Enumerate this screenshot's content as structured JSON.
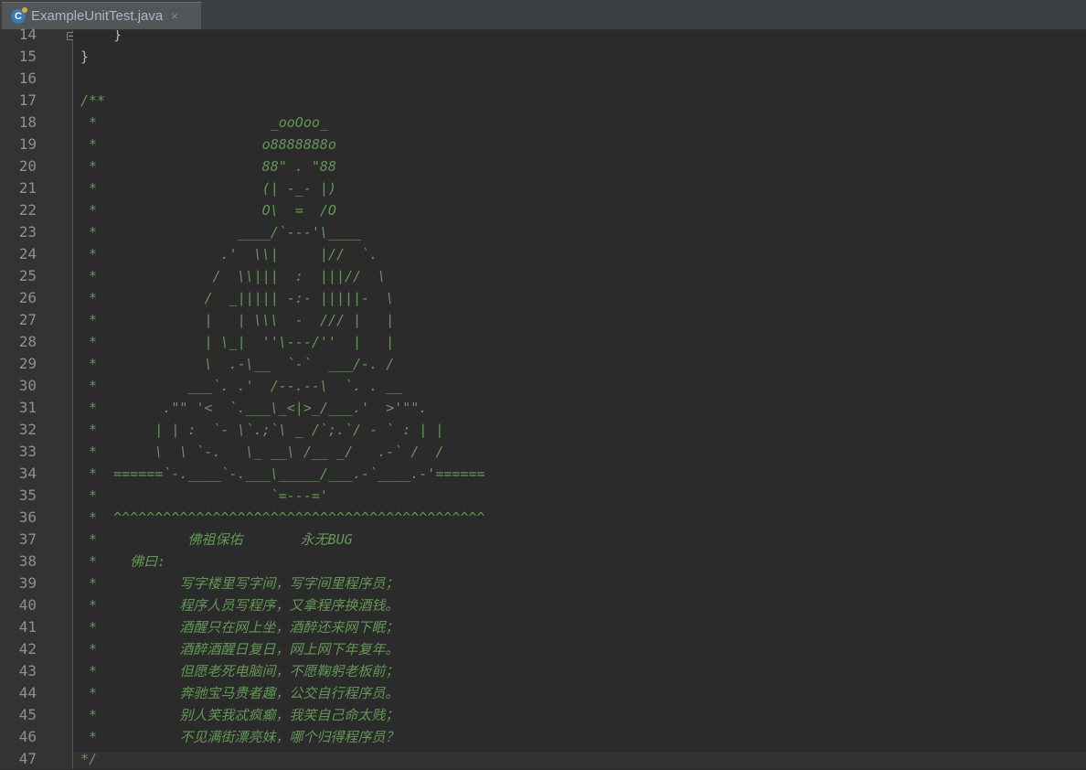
{
  "tab": {
    "icon": "java-class-icon",
    "title": "ExampleUnitTest.java",
    "close": "×"
  },
  "line_numbers": [
    "14",
    "15",
    "16",
    "17",
    "18",
    "19",
    "20",
    "21",
    "22",
    "23",
    "24",
    "25",
    "26",
    "27",
    "28",
    "29",
    "30",
    "31",
    "32",
    "33",
    "34",
    "35",
    "36",
    "37",
    "38",
    "39",
    "40",
    "41",
    "42",
    "43",
    "44",
    "45",
    "46",
    "47"
  ],
  "lines": [
    "    }",
    "}",
    "",
    "/**",
    " *                     _ooOoo_",
    " *                    o8888888o",
    " *                    88\" . \"88",
    " *                    (| -_- |)",
    " *                    O\\  =  /O",
    " *                 ____/`---'\\____",
    " *               .'  \\\\|     |//  `.",
    " *              /  \\\\|||  :  |||//  \\",
    " *             /  _||||| -:- |||||-  \\",
    " *             |   | \\\\\\  -  /// |   |",
    " *             | \\_|  ''\\---/''  |   |",
    " *             \\  .-\\__  `-`  ___/-. /",
    " *           ___`. .'  /--.--\\  `. . __",
    " *        .\"\" '<  `.___\\_<|>_/___.'  >'\"\".",
    " *       | | :  `- \\`.;`\\ _ /`;.`/ - ` : | |",
    " *       \\  \\ `-.   \\_ __\\ /__ _/   .-` /  /",
    " *  ======`-.____`-.___\\_____/___.-`____.-'======",
    " *                     `=---='",
    " *  ^^^^^^^^^^^^^^^^^^^^^^^^^^^^^^^^^^^^^^^^^^^^^",
    " *           佛祖保佑       永无BUG",
    " *    佛曰:",
    " *          写字楼里写字间，写字间里程序员；",
    " *          程序人员写程序，又拿程序换酒钱。",
    " *          酒醒只在网上坐，酒醉还来网下眠；",
    " *          酒醉酒醒日复日，网上网下年复年。",
    " *          但愿老死电脑间，不愿鞠躬老板前；",
    " *          奔驰宝马贵者趣，公交自行程序员。",
    " *          别人笑我忒疯癫，我笑自己命太贱；",
    " *          不见满街漂亮妹，哪个归得程序员？",
    "*/"
  ],
  "colors": {
    "background": "#2b2b2b",
    "gutter": "#313335",
    "comment": "#629755",
    "plain": "#a9b7c6",
    "line_number": "#8e9193"
  }
}
